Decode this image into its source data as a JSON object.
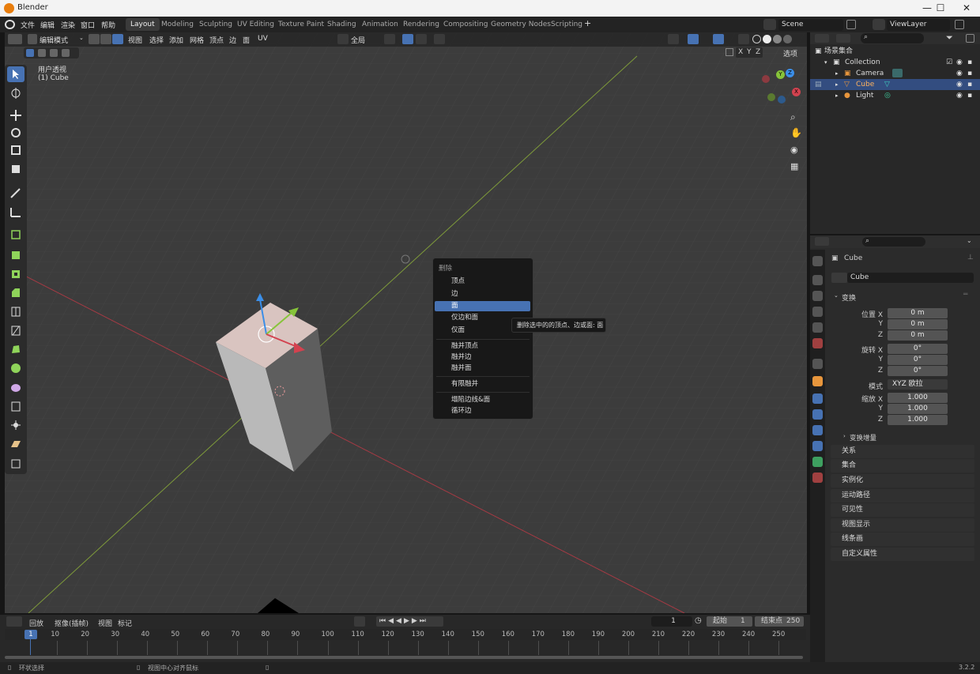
{
  "window": {
    "title": "Blender",
    "controls": [
      "—",
      "☐",
      "✕"
    ]
  },
  "menu": {
    "items": [
      "文件",
      "编辑",
      "渲染",
      "窗口",
      "帮助"
    ]
  },
  "workspaces": [
    "Layout",
    "Modeling",
    "Sculpting",
    "UV Editing",
    "Texture Paint",
    "Shading",
    "Animation",
    "Rendering",
    "Compositing",
    "Geometry Nodes",
    "Scripting"
  ],
  "workspace_add": "+",
  "scene": {
    "name": "Scene",
    "view_layer": "ViewLayer"
  },
  "viewport": {
    "mode": "编辑模式",
    "menus": [
      "视图",
      "选择",
      "添加",
      "网格",
      "顶点",
      "边",
      "面",
      "UV"
    ],
    "transform_orientation": "全局",
    "view_name": "用户透视",
    "object_label": "(1) Cube",
    "axis_buttons": [
      "X",
      "Y",
      "Z"
    ],
    "options": "选项"
  },
  "context_menu": {
    "title": "删除",
    "groups": [
      [
        "顶点",
        "边",
        "面",
        "仅边和面",
        "仅面"
      ],
      [
        "融并顶点",
        "融并边",
        "融并面"
      ],
      [
        "有限融并"
      ],
      [
        "塌陷边线&面",
        "循环边"
      ]
    ],
    "highlighted": "面"
  },
  "tooltip": {
    "text": "删除选中的的顶点、边或面:  面"
  },
  "outliner": {
    "root": "场景集合",
    "collection": "Collection",
    "items": [
      {
        "name": "Camera",
        "selected": false
      },
      {
        "name": "Cube",
        "selected": true
      },
      {
        "name": "Light",
        "selected": false
      }
    ]
  },
  "properties": {
    "object_name": "Cube",
    "data_name": "Cube",
    "section": "变换",
    "location": {
      "label": "位置 X",
      "x": "0 m",
      "y": "0 m",
      "z": "0 m"
    },
    "rotation": {
      "label": "旋转 X",
      "x": "0°",
      "y": "0°",
      "z": "0°"
    },
    "mode_label": "模式",
    "mode_value": "XYZ 欧拉",
    "scale": {
      "label": "缩放 X",
      "x": "1.000",
      "y": "1.000",
      "z": "1.000"
    },
    "axis_y": "Y",
    "axis_z": "Z",
    "delta": "变换增量",
    "panels": [
      "关系",
      "集合",
      "实例化",
      "运动路径",
      "可见性",
      "视图显示",
      "线条画",
      "自定义属性"
    ]
  },
  "timeline": {
    "menus": [
      "回放",
      "抠像(插帧)",
      "视图",
      "标记"
    ],
    "current_frame": "1",
    "start_label": "起始",
    "start": "1",
    "end_label": "结束点",
    "end": "250",
    "ticks": [
      "1",
      "10",
      "20",
      "30",
      "40",
      "50",
      "60",
      "70",
      "80",
      "90",
      "100",
      "110",
      "120",
      "130",
      "140",
      "150",
      "160",
      "170",
      "180",
      "190",
      "200",
      "210",
      "220",
      "230",
      "240",
      "250"
    ]
  },
  "status": {
    "left": "环状选择",
    "middle": "视图中心对齐鼠标",
    "version": "3.2.2"
  },
  "colors": {
    "accent": "#4772b3",
    "x_axis": "#d3424f",
    "y_axis": "#87c43a",
    "z_axis": "#3b8ee8"
  }
}
